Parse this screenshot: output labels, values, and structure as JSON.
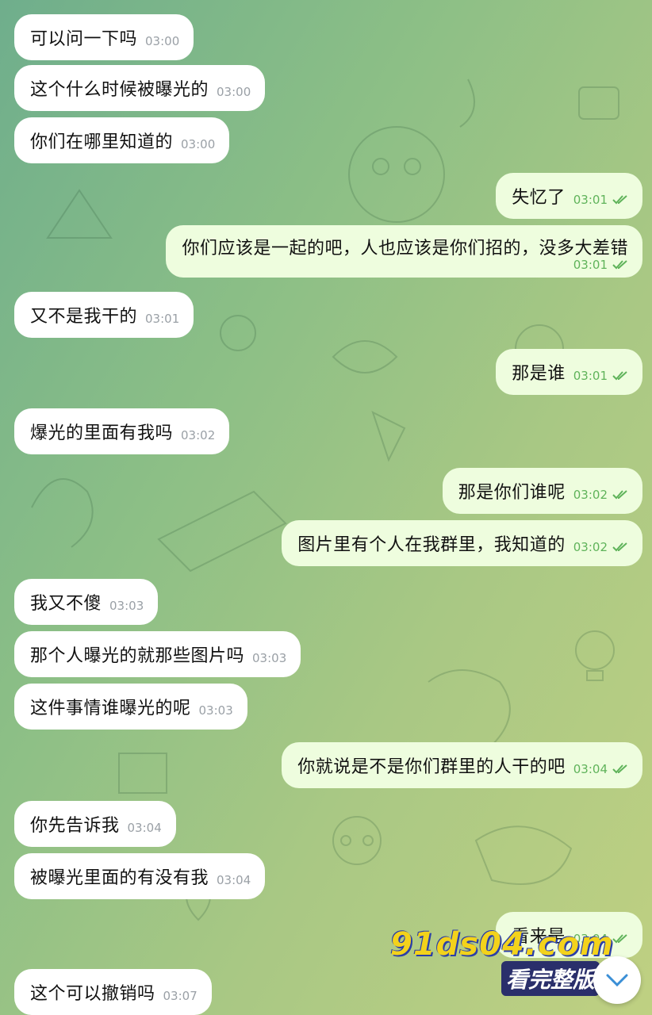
{
  "messages": [
    {
      "dir": "in",
      "text": "可以问一下吗",
      "time": "03:00"
    },
    {
      "dir": "in",
      "text": "这个什么时候被曝光的",
      "time": "03:00"
    },
    {
      "dir": "in",
      "text": "你们在哪里知道的",
      "time": "03:00"
    },
    {
      "dir": "out",
      "text": "失忆了",
      "time": "03:01"
    },
    {
      "dir": "out",
      "text": "你们应该是一起的吧，人也应该是你们招的，没多大差错",
      "time": "03:01"
    },
    {
      "dir": "in",
      "text": "又不是我干的",
      "time": "03:01"
    },
    {
      "dir": "out",
      "text": "那是谁",
      "time": "03:01"
    },
    {
      "dir": "in",
      "text": "爆光的里面有我吗",
      "time": "03:02"
    },
    {
      "dir": "out",
      "text": "那是你们谁呢",
      "time": "03:02"
    },
    {
      "dir": "out",
      "text": "图片里有个人在我群里，我知道的",
      "time": "03:02"
    },
    {
      "dir": "in",
      "text": "我又不傻",
      "time": "03:03"
    },
    {
      "dir": "in",
      "text": "那个人曝光的就那些图片吗",
      "time": "03:03"
    },
    {
      "dir": "in",
      "text": "这件事情谁曝光的呢",
      "time": "03:03"
    },
    {
      "dir": "out",
      "text": "你就说是不是你们群里的人干的吧",
      "time": "03:04"
    },
    {
      "dir": "in",
      "text": "你先告诉我",
      "time": "03:04"
    },
    {
      "dir": "in",
      "text": "被曝光里面的有没有我",
      "time": "03:04"
    },
    {
      "dir": "out",
      "text": "看来是",
      "time": "03:04"
    },
    {
      "dir": "in",
      "text": "这个可以撤销吗",
      "time": "03:07"
    }
  ],
  "watermark": {
    "site": "91ds04.com",
    "caption": "看完整版"
  },
  "icons": {
    "read_receipt": "double-check-icon",
    "scroll_down": "chevron-down-icon"
  },
  "colors": {
    "incoming_bubble": "#ffffff",
    "outgoing_bubble": "#eefdde",
    "check": "#5fb35a",
    "watermark": "#f3d21b"
  }
}
